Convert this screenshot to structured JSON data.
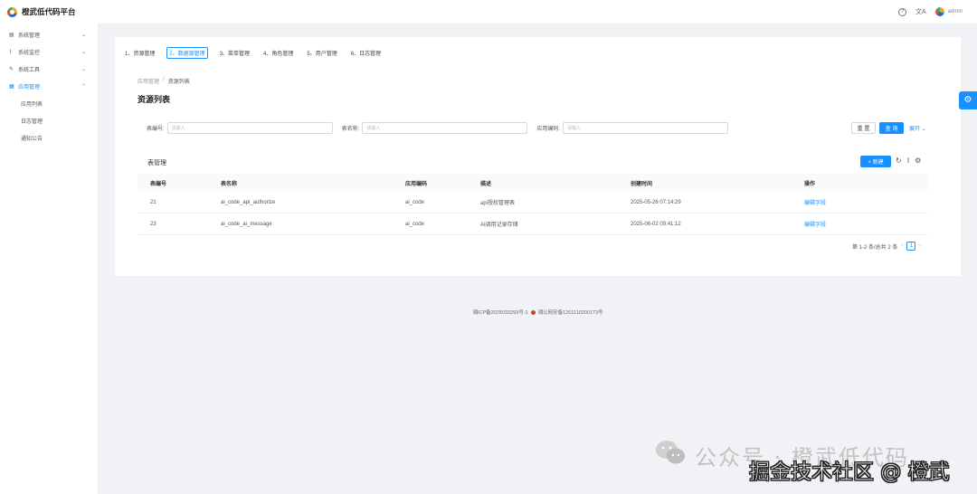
{
  "app": {
    "title": "橙武低代码平台",
    "user": "admin",
    "lang_icon": "文A"
  },
  "sidebar": {
    "items": [
      {
        "label": "系统管理",
        "icon": "table-icon",
        "chevron": "⌄"
      },
      {
        "label": "系统监控",
        "icon": "chart-icon",
        "chevron": "⌄"
      },
      {
        "label": "系统工具",
        "icon": "wrench-icon",
        "chevron": "⌄"
      },
      {
        "label": "应用管理",
        "icon": "app-icon",
        "chevron": "⌃"
      }
    ],
    "subitems": [
      "应用列表",
      "日志管理",
      "通知公告"
    ]
  },
  "steps": [
    "1、资源管理",
    "2、数据源管理",
    "3、菜单管理",
    "4、角色管理",
    "5、用户管理",
    "6、日志管理"
  ],
  "breadcrumb": {
    "parent": "应用管理",
    "sep": "/",
    "current": "资源列表"
  },
  "page_title": "资源列表",
  "filters": [
    {
      "label": "表编号:",
      "placeholder": "请输入"
    },
    {
      "label": "表名称:",
      "placeholder": "请输入"
    },
    {
      "label": "应用编码:",
      "placeholder": "请输入"
    }
  ],
  "buttons": {
    "reset": "重 置",
    "query": "查 询",
    "expand": "展开",
    "new": "+ 新建"
  },
  "table": {
    "title": "表管理",
    "columns": [
      "表编号",
      "表名称",
      "应用编码",
      "描述",
      "创建时间",
      "操作"
    ],
    "rows": [
      {
        "id": "21",
        "name": "ai_code_api_authorize",
        "app": "ai_code",
        "desc": "api授权管理表",
        "created": "2025-05-26 07:14:29",
        "action": "编辑字段"
      },
      {
        "id": "23",
        "name": "ai_code_ai_message",
        "app": "ai_code",
        "desc": "AI调用记录存储",
        "created": "2025-06-02 09:41:12",
        "action": "编辑字段"
      }
    ]
  },
  "pagination": {
    "summary": "第 1-2 条/总共 2 条",
    "current": "1"
  },
  "footer": {
    "icp": "湘ICP备2025033293号-1",
    "police": "湘公网安备1201110200173号"
  },
  "watermark": {
    "line1": "公众号 · 橙武低代码",
    "line2": "掘金技术社区 @ 橙武"
  }
}
